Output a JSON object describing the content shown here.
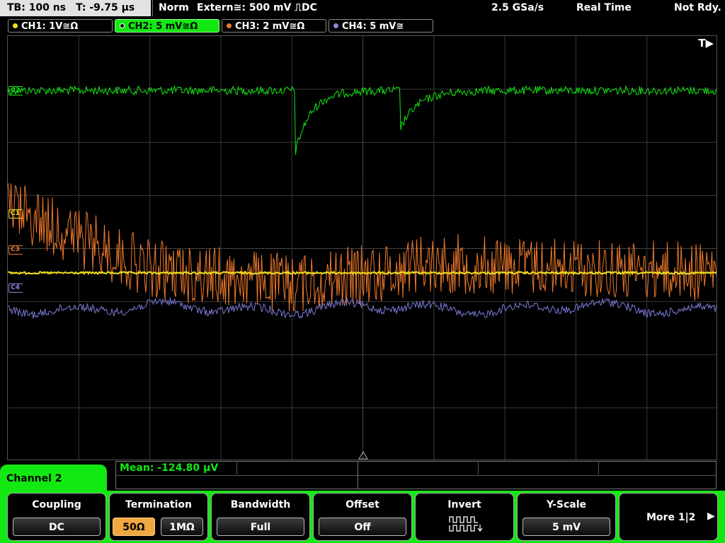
{
  "status": {
    "timebase": "TB: 100 ns",
    "trigger_time": "T: -9.75 µs",
    "mode": "Norm",
    "trigger": "Extern≅: 500 mV ⎍DC",
    "sample_rate": "2.5 GSa/s",
    "acq": "Real Time",
    "state": "Not Rdy."
  },
  "channels": [
    {
      "label": "CH1: 1V≅Ω",
      "color": "#f4e11c"
    },
    {
      "label": "CH2: 5 mV≅Ω",
      "color": "#12e812"
    },
    {
      "label": "CH3: 2 mV≅Ω",
      "color": "#f07a2a"
    },
    {
      "label": "CH4: 5 mV≅",
      "color": "#7b7bd8"
    }
  ],
  "screen": {
    "trigger_indicator": "T▶",
    "markers": {
      "c2": "C2",
      "c1": "C1",
      "c3": "C3",
      "c4": "C4"
    }
  },
  "measurement": {
    "text": "Mean: -124.80 µV"
  },
  "menu": {
    "title": "Channel 2",
    "coupling": {
      "title": "Coupling",
      "value": "DC"
    },
    "termination": {
      "title": "Termination",
      "opt1": "50Ω",
      "opt2": "1MΩ"
    },
    "bandwidth": {
      "title": "Bandwidth",
      "value": "Full"
    },
    "offset": {
      "title": "Offset",
      "value": "Off"
    },
    "invert": {
      "title": "Invert"
    },
    "yscale": {
      "title": "Y-Scale",
      "value": "5 mV"
    },
    "more": {
      "label": "More 1|2"
    }
  }
}
